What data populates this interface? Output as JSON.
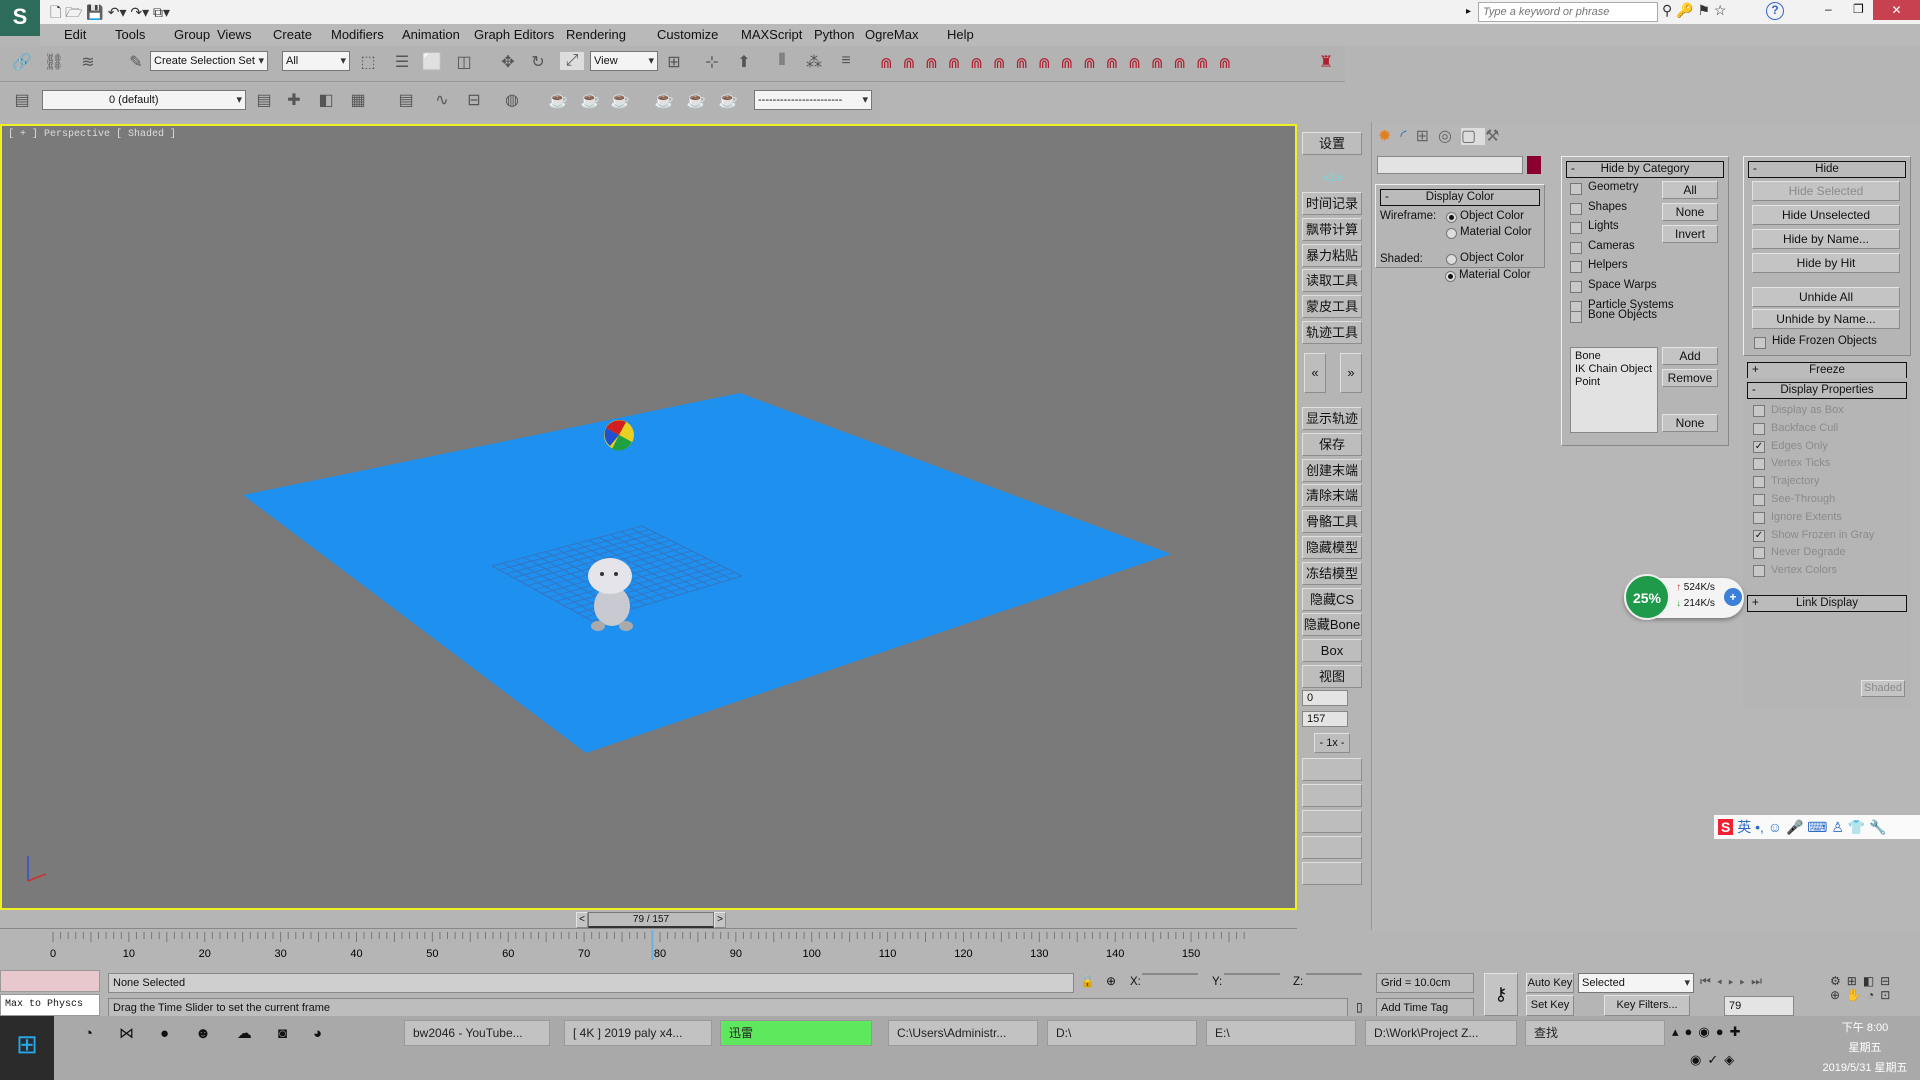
{
  "titlebar": {
    "search_placeholder": "Type a keyword or phrase",
    "minimize": "–",
    "maximize": "❐",
    "close": "✕",
    "help": "?"
  },
  "menus": [
    "Edit",
    "Tools",
    "Group",
    "Views",
    "Create",
    "Modifiers",
    "Animation",
    "Graph Editors",
    "Rendering",
    "Customize",
    "MAXScript",
    "Python",
    "OgreMax",
    "Help"
  ],
  "toolbar": {
    "selection_set": "Create Selection Set",
    "filter": "All",
    "ref_coord": "View",
    "layer": "0 (default)",
    "named_sel": "-----------------------"
  },
  "viewport": {
    "label": "[ + ] Perspective [ Shaded ]",
    "plane_color": "#1e90f0"
  },
  "tool_buttons": {
    "settings": "设置",
    "page": "«1»",
    "items": [
      "时间记录",
      "飘带计算",
      "暴力粘贴",
      "读取工具",
      "蒙皮工具",
      "轨迹工具"
    ],
    "prev": "«",
    "next": "»",
    "items2": [
      "显示轨迹",
      "保存",
      "创建末端",
      "清除末端",
      "骨骼工具",
      "隐藏模型",
      "冻结模型",
      "隐藏CS",
      "隐藏Bone",
      "Box",
      "视图"
    ],
    "start": "0",
    "end": "157",
    "speed": "- 1x -"
  },
  "panel": {
    "object_color": "#8a0030",
    "display_color": {
      "title": "Display Color",
      "sign": "-",
      "wireframe": "Wireframe:",
      "shaded": "Shaded:",
      "object_color": "Object Color",
      "material_color": "Material Color"
    },
    "hide_by_category": {
      "title": "Hide by Category",
      "sign": "-",
      "items": [
        "Geometry",
        "Shapes",
        "Lights",
        "Cameras",
        "Helpers",
        "Space Warps",
        "Particle Systems",
        "Bone Objects"
      ],
      "all": "All",
      "none": "None",
      "invert": "Invert",
      "list": [
        "Bone",
        "IK Chain Object",
        "Point"
      ],
      "add": "Add",
      "remove": "Remove",
      "none2": "None"
    },
    "hide": {
      "title": "Hide",
      "sign": "-",
      "buttons": [
        "Hide Selected",
        "Hide Unselected",
        "Hide by Name...",
        "Hide by Hit"
      ],
      "buttons2": [
        "Unhide All",
        "Unhide by Name..."
      ],
      "hide_frozen": "Hide Frozen Objects"
    },
    "freeze": {
      "title": "Freeze",
      "sign": "+"
    },
    "display_properties": {
      "title": "Display Properties",
      "sign": "-",
      "items": [
        {
          "label": "Display as Box",
          "checked": false
        },
        {
          "label": "Backface Cull",
          "checked": false
        },
        {
          "label": "Edges Only",
          "checked": true
        },
        {
          "label": "Vertex Ticks",
          "checked": false
        },
        {
          "label": "Trajectory",
          "checked": false
        },
        {
          "label": "See-Through",
          "checked": false
        },
        {
          "label": "Ignore Extents",
          "checked": false
        },
        {
          "label": "Show Frozen in Gray",
          "checked": true
        },
        {
          "label": "Never Degrade",
          "checked": false
        },
        {
          "label": "Vertex Colors",
          "checked": false
        }
      ],
      "shaded": "Shaded"
    },
    "link_display": {
      "title": "Link Display",
      "sign": "+"
    }
  },
  "net_widget": {
    "percent": "25%",
    "up": "524K/s",
    "down": "214K/s"
  },
  "ime": {
    "lang": "英"
  },
  "timeline": {
    "slider": "79 / 157",
    "current": 79,
    "total": 157,
    "labels": [
      "0",
      "10",
      "20",
      "30",
      "40",
      "50",
      "60",
      "70",
      "80",
      "90",
      "100",
      "110",
      "120",
      "130",
      "140",
      "150"
    ],
    "prev": "<",
    "next": ">"
  },
  "status": {
    "selection": "None Selected",
    "prompt": "Drag the Time Slider to set the current frame",
    "x": "X:",
    "y": "Y:",
    "z": "Z:",
    "grid": "Grid = 10.0cm",
    "add_time_tag": "Add Time Tag",
    "auto_key": "Auto Key",
    "set_key": "Set Key",
    "key_mode": "Selected",
    "key_filters": "Key Filters...",
    "frame": "79",
    "script_label": "Max to Physcs"
  },
  "taskbar": {
    "tasks": [
      "bw2046 - YouTube...",
      "[ 4K ] 2019 paly x4...",
      "迅雷",
      "C:\\Users\\Administr...",
      "D:\\",
      "E:\\",
      "D:\\Work\\Project Z...",
      "查找"
    ],
    "time": "下午 8:00",
    "weekday": "星期五",
    "date": "2019/5/31 星期五"
  }
}
